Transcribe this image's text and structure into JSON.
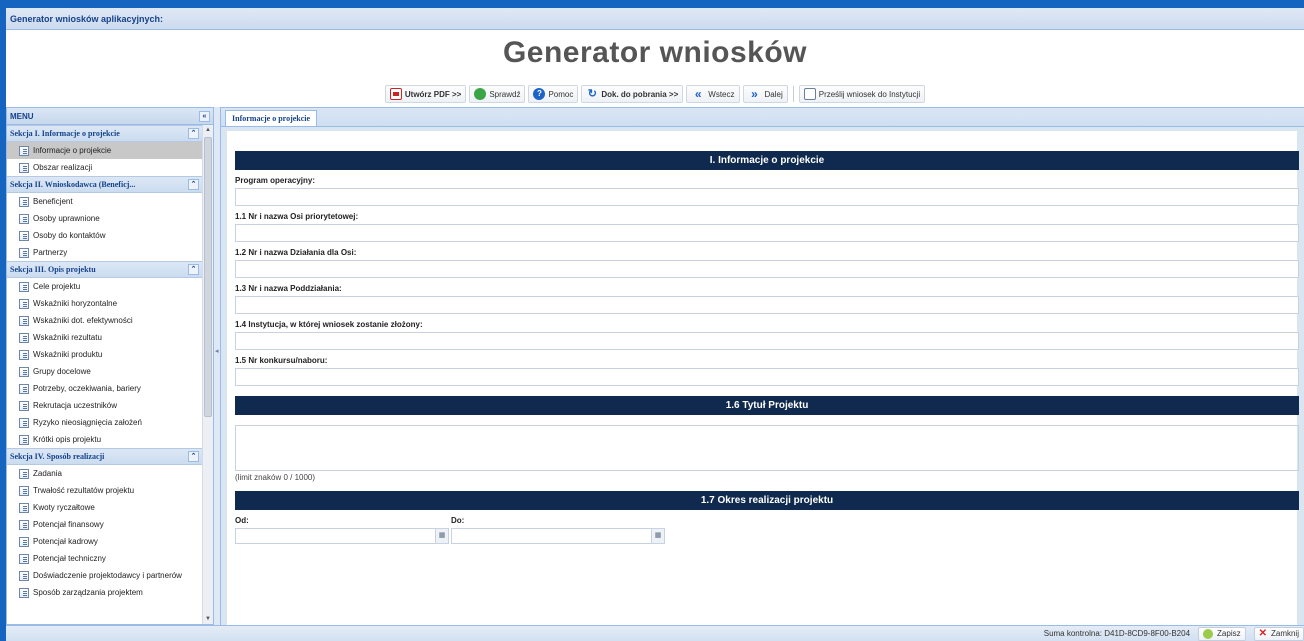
{
  "window": {
    "title": "Generator wniosków aplikacyjnych:"
  },
  "header": {
    "title": "Generator wniosków"
  },
  "toolbar": {
    "create_pdf": "Utwórz PDF >>",
    "check": "Sprawdź",
    "help": "Pomoc",
    "documents": "Dok. do pobrania >>",
    "back": "Wstecz",
    "next": "Dalej",
    "send": "Prześlij wniosek do Instytucji"
  },
  "sidebar": {
    "title": "MENU",
    "sections": [
      {
        "title": "Sekcja I. Informacje o projekcie",
        "items": [
          "Informacje o projekcie",
          "Obszar realizacji"
        ]
      },
      {
        "title": "Sekcja II. Wnioskodawca (Beneficj...",
        "items": [
          "Beneficjent",
          "Osoby uprawnione",
          "Osoby do kontaktów",
          "Partnerzy"
        ]
      },
      {
        "title": "Sekcja III. Opis projektu",
        "items": [
          "Cele projektu",
          "Wskaźniki horyzontalne",
          "Wskaźniki dot. efektywności",
          "Wskaźniki rezultatu",
          "Wskaźniki produktu",
          "Grupy docelowe",
          "Potrzeby, oczekiwania, bariery",
          "Rekrutacja uczestników",
          "Ryzyko nieosiągnięcia założeń",
          "Krótki opis projektu"
        ]
      },
      {
        "title": "Sekcja IV. Sposób realizacji",
        "items": [
          "Zadania",
          "Trwałość rezultatów projektu",
          "Kwoty ryczałtowe",
          "Potencjał finansowy",
          "Potencjał kadrowy",
          "Potencjał techniczny",
          "Doświadczenie projektodawcy i partnerów",
          "Sposób zarządzania projektem"
        ]
      }
    ],
    "active_item": "Informacje o projekcie"
  },
  "main": {
    "tab": "Informacje o projekcie",
    "band1": "I. Informacje o projekcie",
    "fields": [
      {
        "label": "Program operacyjny:",
        "value": ""
      },
      {
        "label": "1.1 Nr i nazwa Osi priorytetowej:",
        "value": ""
      },
      {
        "label": "1.2 Nr i nazwa Działania dla Osi:",
        "value": ""
      },
      {
        "label": "1.3 Nr i nazwa Poddziałania:",
        "value": ""
      },
      {
        "label": "1.4 Instytucja, w której wniosek zostanie złożony:",
        "value": ""
      },
      {
        "label": "1.5 Nr konkursu/naboru:",
        "value": ""
      }
    ],
    "band2": "1.6 Tytuł Projektu",
    "limit": "(limit znaków 0 / 1000)",
    "band3": "1.7 Okres realizacji projektu",
    "from_label": "Od:",
    "to_label": "Do:"
  },
  "status": {
    "checksum": "Suma kontrolna: D41D-8CD9-8F00-B204",
    "save": "Zapisz",
    "close": "Zamknij"
  },
  "colors": {
    "accent": "#1565c0",
    "band": "#102a4f",
    "frame_border": "#99bbe8"
  }
}
